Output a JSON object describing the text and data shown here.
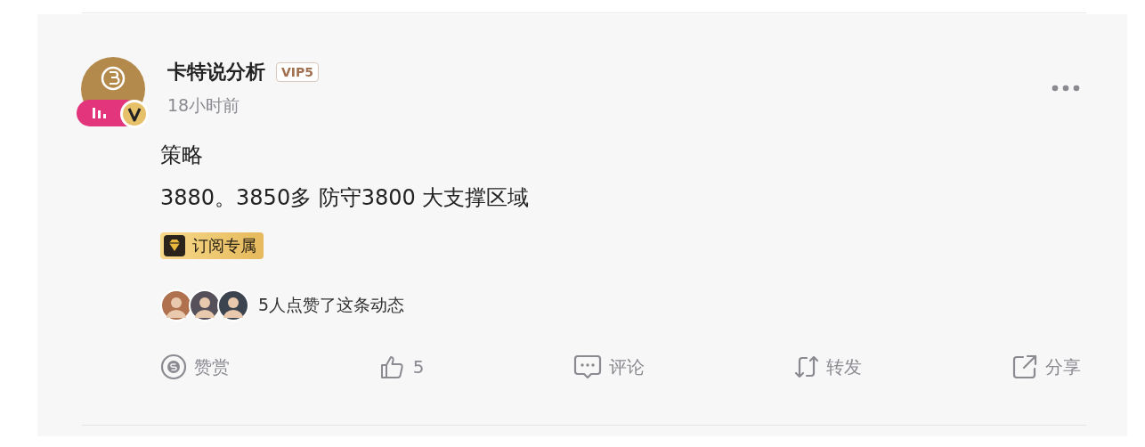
{
  "post": {
    "author": "卡特说分析",
    "vip_badge": "VIP5",
    "time": "18小时前",
    "content": [
      "策略",
      "3880。3850多 防守3800 大支撑区域"
    ],
    "tag": "订阅专属",
    "likes_text": "5人点赞了这条动态",
    "liker_avatars": [
      {
        "color": "#b0714f"
      },
      {
        "color": "#55505a"
      },
      {
        "color": "#3c4450"
      }
    ],
    "actions": [
      {
        "kind": "reward",
        "label": "赞赏"
      },
      {
        "kind": "like",
        "label": "5"
      },
      {
        "kind": "comment",
        "label": "评论"
      },
      {
        "kind": "repost",
        "label": "转发"
      },
      {
        "kind": "share",
        "label": "分享"
      }
    ]
  }
}
